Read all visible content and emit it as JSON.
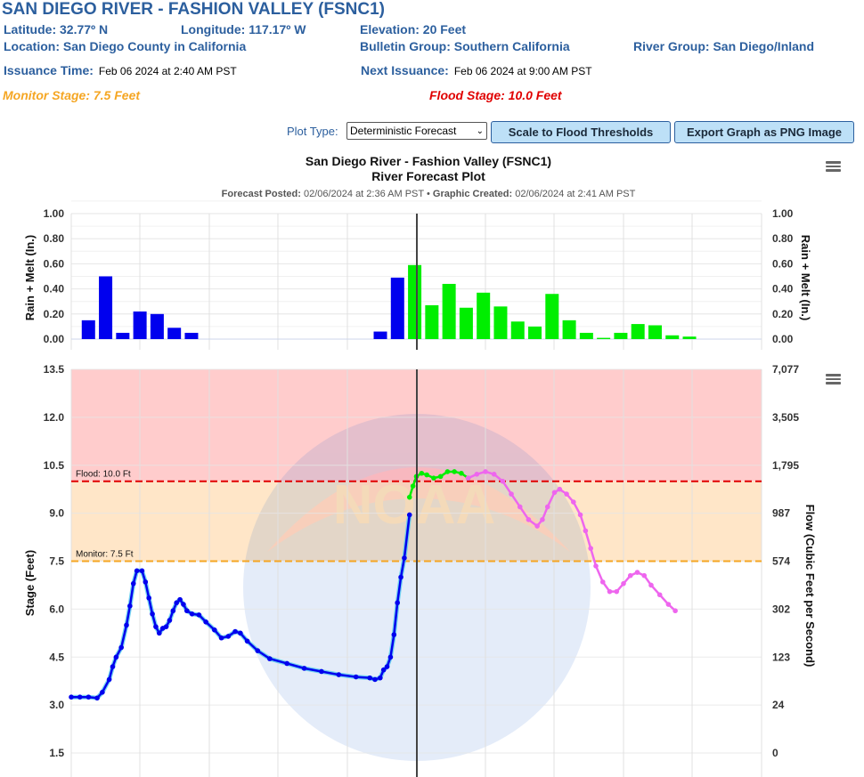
{
  "header": {
    "title": "SAN DIEGO RIVER - FASHION VALLEY (FSNC1)",
    "latitude": "Latitude: 32.77º N",
    "longitude": "Longitude: 117.17º W",
    "elevation": "Elevation: 20 Feet",
    "location": "Location: San Diego County in California",
    "bulletin_group": "Bulletin Group: Southern California",
    "river_group": "River Group: San Diego/Inland",
    "issuance_label": "Issuance Time:",
    "issuance_value": "Feb 06 2024 at 2:40 AM PST",
    "next_issuance_label": "Next Issuance:",
    "next_issuance_value": "Feb 06 2024 at 9:00 AM PST",
    "monitor_stage": "Monitor Stage: 7.5 Feet",
    "flood_stage": "Flood Stage: 10.0 Feet"
  },
  "controls": {
    "plot_type_label": "Plot Type:",
    "plot_type_selected": "Deterministic Forecast",
    "scale_button": "Scale to Flood Thresholds",
    "export_button": "Export Graph as PNG Image"
  },
  "colors": {
    "brand": "#2c5f9e",
    "monitor": "#f5a623",
    "flood": "#e00000",
    "observed": "#0000ee",
    "forecast_precip": "#00ee00",
    "forecast_stage": "#ee66ee"
  },
  "chart_data": [
    {
      "type": "bar",
      "title": "San Diego River - Fashion Valley (FSNC1)",
      "subtitle": "River Forecast Plot",
      "meta_posted_label": "Forecast Posted:",
      "meta_posted": "02/06/2024 at 2:36 AM PST",
      "meta_sep": "•",
      "meta_created_label": "Graphic Created:",
      "meta_created": "02/06/2024 at 2:41 AM PST",
      "ylabel": "Rain + Melt (In.)",
      "ylabel_right": "Rain + Melt (In.)",
      "ylim": [
        0,
        1.0
      ],
      "yticks": [
        "0.00",
        "0.20",
        "0.40",
        "0.60",
        "0.80",
        "1.00"
      ],
      "grid": true,
      "series": [
        {
          "name": "Observed",
          "color": "#0000ee",
          "points": [
            [
              0.5,
              0.15
            ],
            [
              1.5,
              0.5
            ],
            [
              2.5,
              0.05
            ],
            [
              3.5,
              0.22
            ],
            [
              4.5,
              0.2
            ],
            [
              5.5,
              0.09
            ],
            [
              6.5,
              0.05
            ],
            [
              17.5,
              0.06
            ],
            [
              18.5,
              0.49
            ]
          ]
        },
        {
          "name": "Forecast",
          "color": "#00ee00",
          "points": [
            [
              19.5,
              0.59
            ],
            [
              20.5,
              0.27
            ],
            [
              21.5,
              0.44
            ],
            [
              22.5,
              0.25
            ],
            [
              23.5,
              0.37
            ],
            [
              24.5,
              0.26
            ],
            [
              25.5,
              0.14
            ],
            [
              26.5,
              0.1
            ],
            [
              27.5,
              0.36
            ],
            [
              28.5,
              0.15
            ],
            [
              29.5,
              0.05
            ],
            [
              30.5,
              0.01
            ],
            [
              31.5,
              0.05
            ],
            [
              32.5,
              0.12
            ],
            [
              33.5,
              0.11
            ],
            [
              34.5,
              0.03
            ],
            [
              35.5,
              0.02
            ]
          ]
        }
      ],
      "x_range": [
        -0.5,
        39.7
      ],
      "now_index": 19.6
    },
    {
      "type": "line",
      "ylabel": "Stage (Feet)",
      "ylabel_right": "Flow (Cubic Feet per Second)",
      "ylim": [
        0.75,
        13.5
      ],
      "yticks": [
        "1.5",
        "3.0",
        "4.5",
        "6.0",
        "7.5",
        "9.0",
        "10.5",
        "12.0",
        "13.5"
      ],
      "yticks_right": [
        "0",
        "24",
        "123",
        "302",
        "574",
        "987",
        "1,795",
        "3,505",
        "7,077"
      ],
      "grid": true,
      "thresholds": [
        {
          "name": "Flood",
          "label": "Flood: 10.0 Ft",
          "value": 10.0,
          "color": "#e00000"
        },
        {
          "name": "Monitor",
          "label": "Monitor: 7.5 Ft",
          "value": 7.5,
          "color": "#f5a623"
        }
      ],
      "bands": [
        {
          "from": 10.0,
          "to": 13.5,
          "color": "#ffcccc"
        },
        {
          "from": 7.5,
          "to": 10.0,
          "color": "#ffe6c8"
        }
      ],
      "watermark": "NOAA",
      "series": [
        {
          "name": "Observed",
          "color": "#0000ee",
          "points": [
            [
              0,
              3.25
            ],
            [
              0.5,
              3.25
            ],
            [
              1,
              3.25
            ],
            [
              1.5,
              3.22
            ],
            [
              1.8,
              3.4
            ],
            [
              2.2,
              3.8
            ],
            [
              2.4,
              4.2
            ],
            [
              2.6,
              4.5
            ],
            [
              2.9,
              4.8
            ],
            [
              3.2,
              5.5
            ],
            [
              3.4,
              6.1
            ],
            [
              3.6,
              6.8
            ],
            [
              3.8,
              7.2
            ],
            [
              4.1,
              7.2
            ],
            [
              4.3,
              6.85
            ],
            [
              4.5,
              6.35
            ],
            [
              4.7,
              5.85
            ],
            [
              4.9,
              5.45
            ],
            [
              5.1,
              5.25
            ],
            [
              5.3,
              5.4
            ],
            [
              5.5,
              5.45
            ],
            [
              5.7,
              5.65
            ],
            [
              5.9,
              5.95
            ],
            [
              6.1,
              6.2
            ],
            [
              6.3,
              6.3
            ],
            [
              6.5,
              6.15
            ],
            [
              6.7,
              5.95
            ],
            [
              7.0,
              5.85
            ],
            [
              7.4,
              5.82
            ],
            [
              7.8,
              5.6
            ],
            [
              8.3,
              5.35
            ],
            [
              8.7,
              5.1
            ],
            [
              9.1,
              5.15
            ],
            [
              9.5,
              5.3
            ],
            [
              9.8,
              5.25
            ],
            [
              10.2,
              5.0
            ],
            [
              10.8,
              4.7
            ],
            [
              11.5,
              4.45
            ],
            [
              12.5,
              4.3
            ],
            [
              13.5,
              4.15
            ],
            [
              14.5,
              4.05
            ],
            [
              15.5,
              3.95
            ],
            [
              16.5,
              3.88
            ],
            [
              17.3,
              3.85
            ],
            [
              17.6,
              3.8
            ],
            [
              17.9,
              3.85
            ],
            [
              18.1,
              4.1
            ],
            [
              18.3,
              4.2
            ],
            [
              18.5,
              4.5
            ],
            [
              18.7,
              5.2
            ],
            [
              18.9,
              6.2
            ],
            [
              19.1,
              7.0
            ],
            [
              19.3,
              7.6
            ],
            [
              19.6,
              8.95
            ]
          ]
        },
        {
          "name": "Forecast",
          "color": "#00ee00",
          "points": [
            [
              19.6,
              9.5
            ],
            [
              19.8,
              9.85
            ],
            [
              20.0,
              10.15
            ],
            [
              20.3,
              10.25
            ],
            [
              20.6,
              10.2
            ],
            [
              21.0,
              10.1
            ],
            [
              21.4,
              10.15
            ],
            [
              21.8,
              10.3
            ],
            [
              22.2,
              10.3
            ],
            [
              22.6,
              10.25
            ],
            [
              23.0,
              10.1
            ]
          ]
        },
        {
          "name": "Forecast (continued)",
          "color": "#ee66ee",
          "points": [
            [
              23.0,
              10.1
            ],
            [
              23.5,
              10.22
            ],
            [
              24.0,
              10.3
            ],
            [
              24.5,
              10.22
            ],
            [
              25.0,
              10.0
            ],
            [
              25.5,
              9.6
            ],
            [
              26.0,
              9.2
            ],
            [
              26.5,
              8.8
            ],
            [
              27.0,
              8.6
            ],
            [
              27.3,
              8.8
            ],
            [
              27.6,
              9.2
            ],
            [
              28.0,
              9.65
            ],
            [
              28.3,
              9.75
            ],
            [
              28.7,
              9.6
            ],
            [
              29.1,
              9.35
            ],
            [
              29.5,
              8.95
            ],
            [
              29.8,
              8.45
            ],
            [
              30.1,
              7.9
            ],
            [
              30.4,
              7.35
            ],
            [
              30.8,
              6.85
            ],
            [
              31.2,
              6.55
            ],
            [
              31.6,
              6.55
            ],
            [
              32.0,
              6.8
            ],
            [
              32.4,
              7.05
            ],
            [
              32.8,
              7.15
            ],
            [
              33.2,
              7.05
            ],
            [
              33.6,
              6.75
            ],
            [
              34.1,
              6.45
            ],
            [
              34.6,
              6.15
            ],
            [
              35.0,
              5.95
            ]
          ]
        }
      ],
      "x_range": [
        0,
        40
      ],
      "now_index": 19.6
    }
  ]
}
